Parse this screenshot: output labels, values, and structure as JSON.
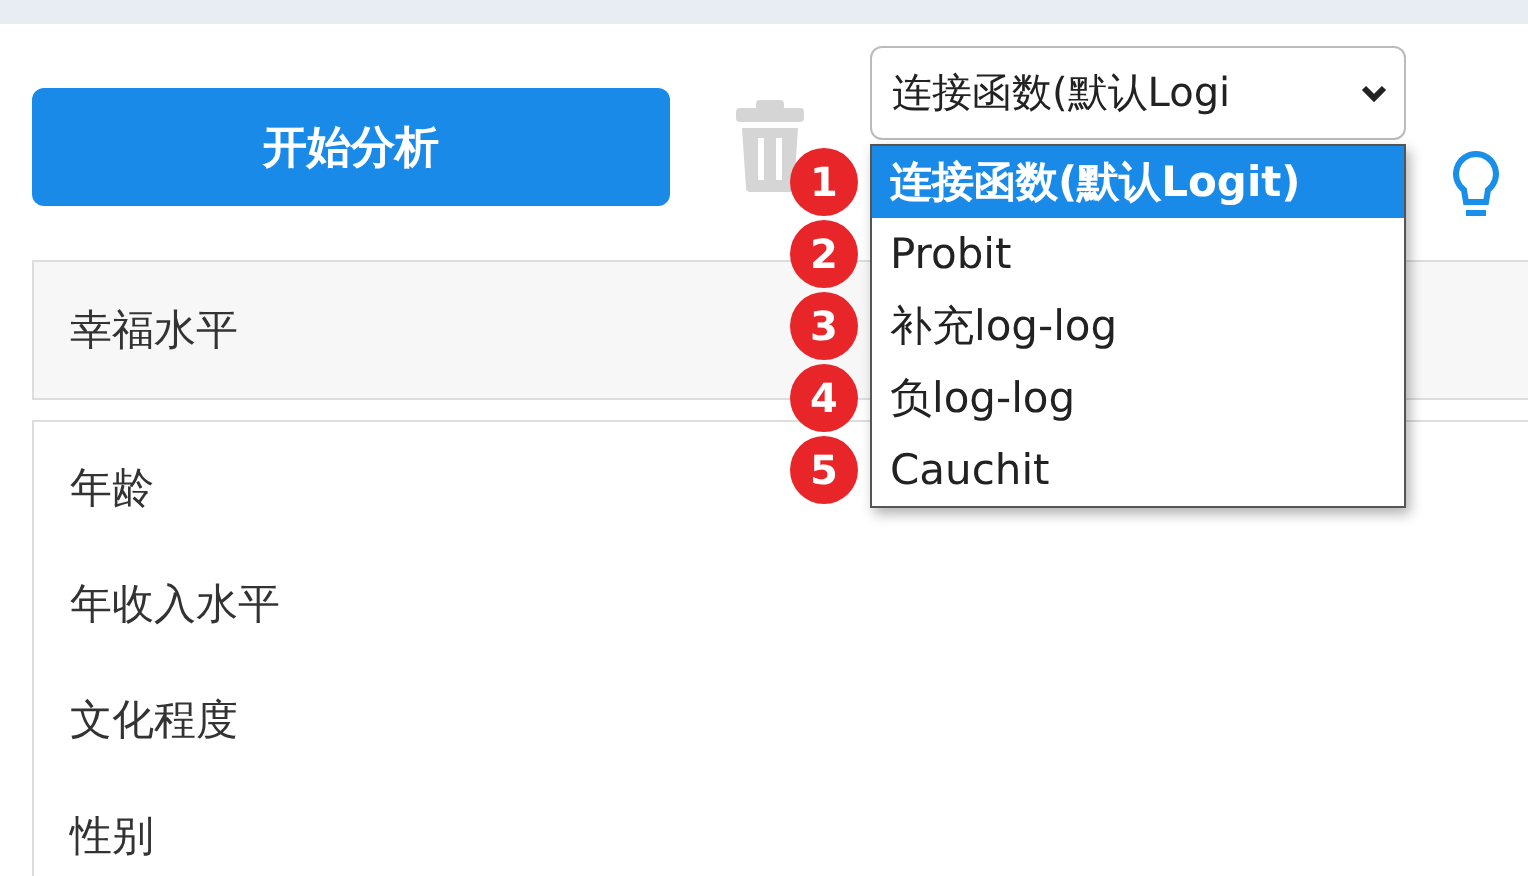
{
  "toolbar": {
    "analyze_button": "开始分析",
    "link_function_select": {
      "value": "连接函数(默认Logi"
    }
  },
  "dropdown": {
    "options": [
      {
        "badge": "1",
        "label": "连接函数(默认Logit)",
        "selected": true
      },
      {
        "badge": "2",
        "label": "Probit",
        "selected": false
      },
      {
        "badge": "3",
        "label": "补充log-log",
        "selected": false
      },
      {
        "badge": "4",
        "label": "负log-log",
        "selected": false
      },
      {
        "badge": "5",
        "label": "Cauchit",
        "selected": false
      }
    ]
  },
  "dependent_variable": "幸福水平",
  "independent_variables": [
    "年龄",
    "年收入水平",
    "文化程度",
    "性别"
  ]
}
